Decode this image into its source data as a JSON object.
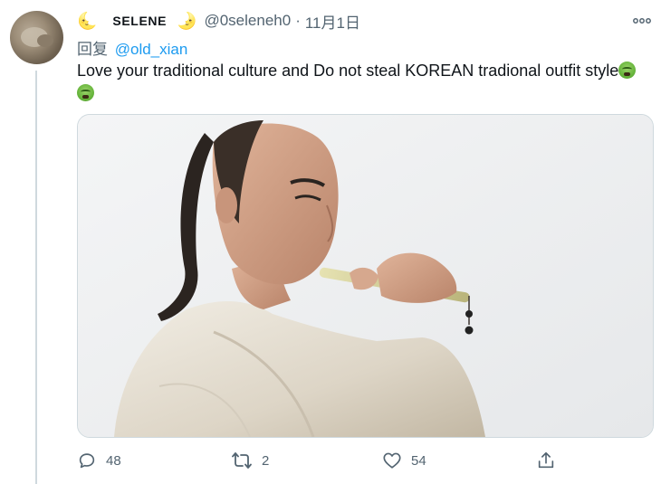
{
  "tweet": {
    "display_name": "SELENE",
    "name_emoji_left": "🌜",
    "name_emoji_right": "🌛",
    "handle": "@0seleneh0",
    "separator": "·",
    "date": "11月1日",
    "reply_prefix": "回复",
    "reply_mention": "@old_xian",
    "text": "Love your traditional culture and Do not steal KOREAN tradional outfit style",
    "emoji_names": [
      "nauseated-face",
      "nauseated-face"
    ]
  },
  "media": {
    "description_icon": "photo"
  },
  "actions": {
    "reply_count": "48",
    "retweet_count": "2",
    "like_count": "54"
  },
  "colors": {
    "text": "#0f1419",
    "secondary": "#536471",
    "link": "#1d9bf0",
    "border": "#cfd9de"
  }
}
